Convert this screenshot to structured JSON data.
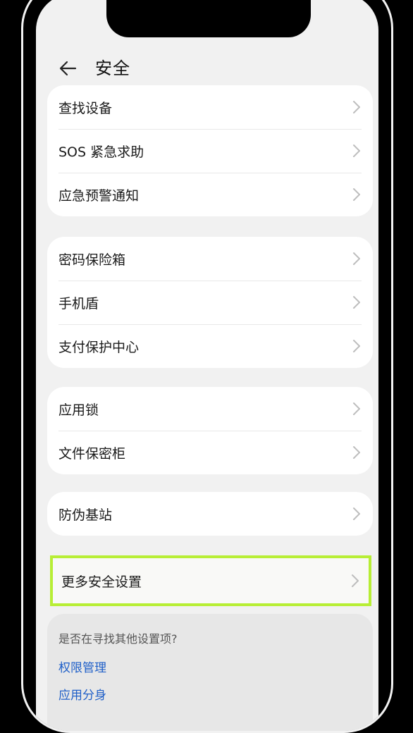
{
  "header": {
    "title": "安全"
  },
  "groups": [
    {
      "items": [
        "查找设备",
        "SOS 紧急求助",
        "应急预警通知"
      ]
    },
    {
      "items": [
        "密码保险箱",
        "手机盾",
        "支付保护中心"
      ]
    },
    {
      "items": [
        "应用锁",
        "文件保密柜"
      ]
    },
    {
      "items": [
        "防伪基站"
      ]
    }
  ],
  "highlighted_item": "更多安全设置",
  "suggestions": {
    "question": "是否在寻找其他设置项?",
    "links": [
      "权限管理",
      "应用分身"
    ]
  },
  "colors": {
    "highlight_border": "#b7ee35",
    "link": "#1f5fc8"
  }
}
